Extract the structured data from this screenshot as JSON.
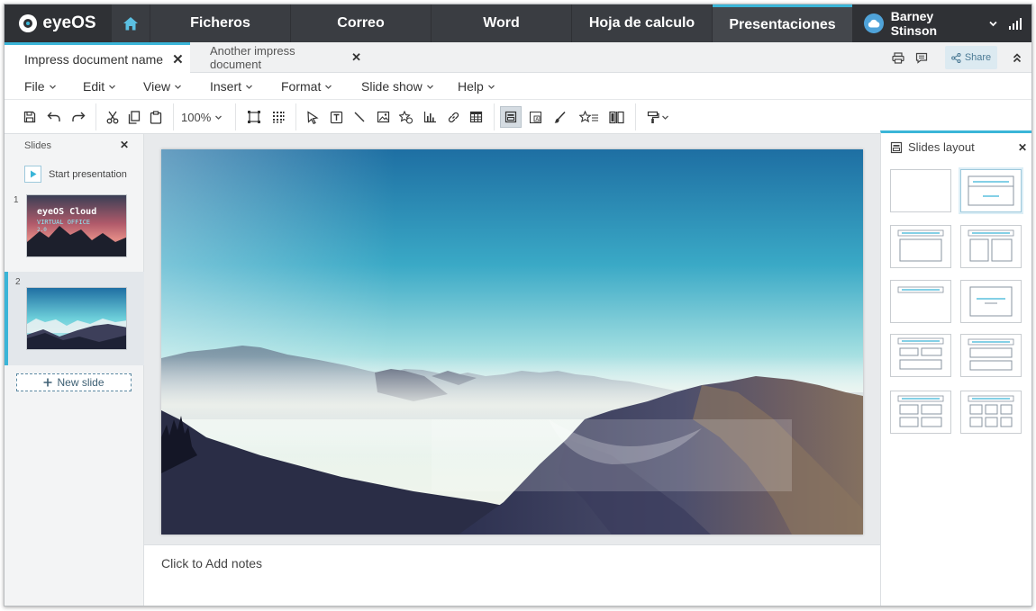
{
  "app": {
    "logo": "eyeOS"
  },
  "nav": {
    "items": [
      {
        "label": "Ficheros"
      },
      {
        "label": "Correo"
      },
      {
        "label": "Word"
      },
      {
        "label": "Hoja de calculo"
      },
      {
        "label": "Presentaciones",
        "active": true
      }
    ],
    "user": "Barney Stinson"
  },
  "tabs": [
    {
      "label": "Impress document name",
      "active": true
    },
    {
      "label": "Another impress document",
      "active": false
    }
  ],
  "share_label": "Share",
  "menu": [
    "File",
    "Edit",
    "View",
    "Insert",
    "Format",
    "Slide show",
    "Help"
  ],
  "toolbar": {
    "zoom": "100%",
    "icons": [
      "save-icon",
      "undo-icon",
      "redo-icon",
      "cut-icon",
      "copy-icon",
      "paste-icon",
      "fit-page-icon",
      "grid-icon",
      "pointer-icon",
      "textbox-icon",
      "line-icon",
      "image-icon",
      "shapes-icon",
      "chart-icon",
      "link-icon",
      "table-icon",
      "slide-layout-icon",
      "text-frame-icon",
      "brush-icon",
      "effects-icon",
      "transition-icon",
      "format-paint-icon"
    ]
  },
  "slides_panel": {
    "title": "Slides",
    "start": "Start presentation",
    "new_slide": "New slide",
    "slides": [
      {
        "num": "1",
        "title_line": "eyeOS Cloud",
        "sub_line": "VIRTUAL OFFICE",
        "ver_line": "2.0"
      },
      {
        "num": "2"
      }
    ]
  },
  "notes_placeholder": "Click to Add notes",
  "layout_panel": {
    "title": "Slides layout"
  },
  "colors": {
    "accent": "#3ab5d8",
    "topbar": "#2f3135"
  }
}
